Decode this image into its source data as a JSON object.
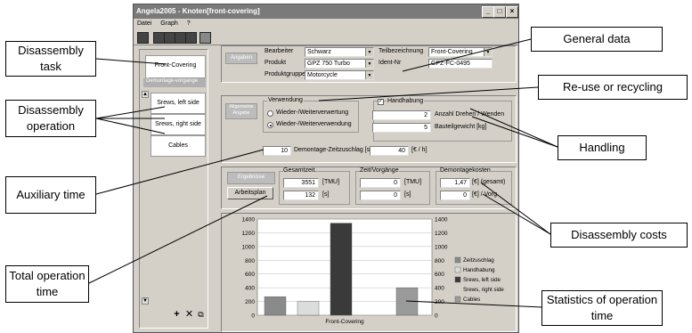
{
  "window": {
    "title": "Angela2005 - Knoten[front-covering]",
    "menu": [
      "Datei",
      "Graph",
      "?"
    ]
  },
  "left_panel": {
    "tasks": [
      "Front-Covering"
    ],
    "section_label": "Demontage-vorgange",
    "operations": [
      "Srews, left side",
      "Srews, right side",
      "Cables"
    ],
    "bottom_icons": [
      "add-icon",
      "delete-icon",
      "copy-icon"
    ]
  },
  "general": {
    "tab_label": "Angaben",
    "bearbeiter_label": "Bearbeiter",
    "bearbeiter_value": "Schwarz",
    "produkt_label": "Produkt",
    "produkt_value": "GPZ 750 Turbo",
    "produktgruppe_label": "Produktgruppe",
    "produktgruppe_value": "Motorcycle",
    "teilbezeichnung_label": "Teilbezeichnung",
    "teilbezeichnung_value": "Front-Covering",
    "ident_label": "Ident-Nr",
    "ident_value": "GPZ-FC-0495"
  },
  "details": {
    "tab_label": "Allgemeine Angabe",
    "verwendung_label": "Verwendung",
    "radio_1": "Wieder-/Weiterverwertung",
    "radio_2": "Wieder-/Weiterverwendung",
    "handhabung_label": "Handhabung",
    "drehen_value": "2",
    "drehen_label": "Anzahl Drehen / Wenden",
    "gewicht_value": "5",
    "gewicht_label": "Bauteilgewicht [kg]",
    "zuschlag_value": "10",
    "zuschlag_label": "Demontage-Zeitzuschlag [s]",
    "rate_value": "40",
    "rate_label": "[€ / h]"
  },
  "results": {
    "ergebnisse_label": "Ergebnisse",
    "arbeitsplan_label": "Arbeitsplan",
    "gesamtzeit_label": "Gesamtzeit",
    "gesamt_tmu": "3551",
    "tmu_unit": "[TMU]",
    "gesamt_s": "132",
    "s_unit": "[s]",
    "zeit_label": "Zeit/Vorgänge",
    "zeit_tmu": "0",
    "zeit_s": "0",
    "kosten_label": "Demontagekosten",
    "kosten_gesamt": "1,47",
    "kosten_gesamt_unit": "[€] (gesamt)",
    "kosten_vorg": "0",
    "kosten_vorg_unit": "[€] / Vorg"
  },
  "chart_data": {
    "type": "bar",
    "categories": [
      "Front-Covering"
    ],
    "y_ticks": [
      "0",
      "200",
      "400",
      "600",
      "800",
      "1000",
      "1200",
      "1400"
    ],
    "ylim": [
      0,
      1400
    ],
    "series": [
      {
        "name": "Zeitzuschlag",
        "value": 270,
        "color": "#8a8a8a"
      },
      {
        "name": "Handhabung",
        "value": 200,
        "color": "#dcdcdc"
      },
      {
        "name": "Srews, left side",
        "value": 1340,
        "color": "#3a3a3a"
      },
      {
        "name": "Srews, right side",
        "value": 0,
        "color": "#ffffff"
      },
      {
        "name": "Cables",
        "value": 400,
        "color": "#9a9a9a"
      }
    ],
    "grid": true,
    "legend_position": "right"
  },
  "annotations": {
    "disassembly_task": "Disassembly task",
    "disassembly_operation": "Disassembly operation",
    "auxiliary_time": "Auxiliary time",
    "total_operation_time": "Total operation time",
    "general_data": "General data",
    "reuse_recycling": "Re-use or recycling",
    "handling": "Handling",
    "disassembly_costs": "Disassembly costs",
    "statistics": "Statistics of operation time"
  }
}
